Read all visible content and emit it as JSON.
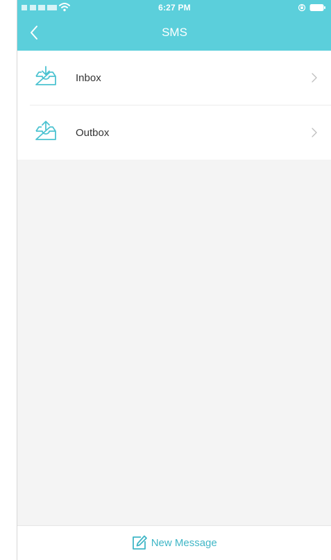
{
  "status_bar": {
    "time": "6:27 PM"
  },
  "nav": {
    "title": "SMS",
    "back_icon": "chevron-left-icon"
  },
  "list": {
    "items": [
      {
        "label": "Inbox",
        "icon": "inbox-download-icon"
      },
      {
        "label": "Outbox",
        "icon": "outbox-upload-icon"
      }
    ]
  },
  "footer": {
    "new_message_label": "New Message",
    "icon": "edit-icon"
  },
  "colors": {
    "header": "#5bcfdb",
    "accent": "#3fb6c6",
    "background": "#f4f4f4"
  }
}
